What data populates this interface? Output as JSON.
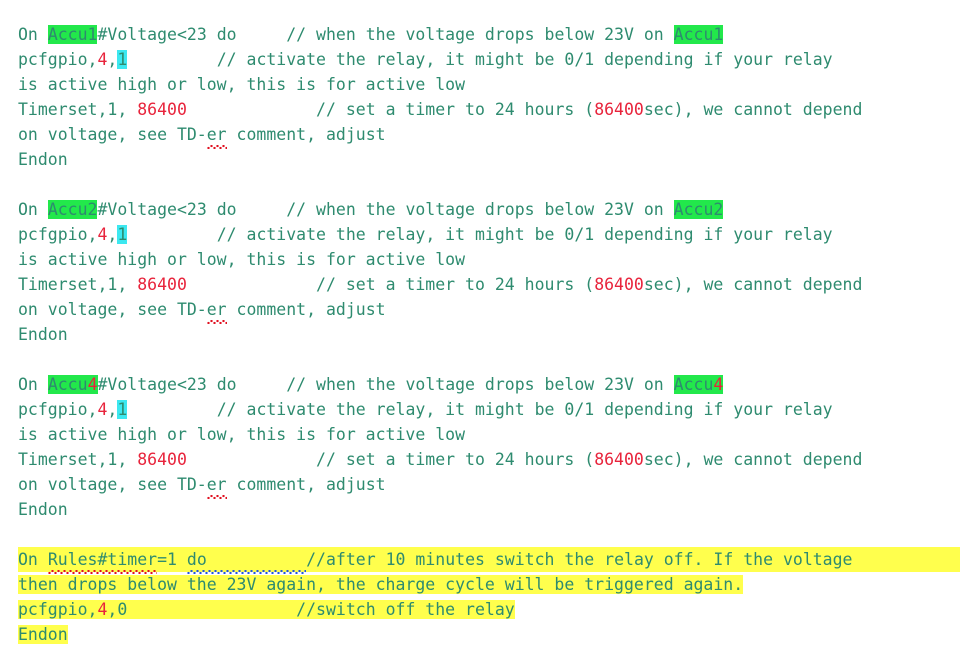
{
  "document": {
    "type": "code-editor-text",
    "language": "tasmota-rules",
    "colors": {
      "text": "#2e8b6f",
      "number": "#e8243c",
      "highlight_green": "#22e84b",
      "highlight_cyan": "#3ce8f0",
      "highlight_yellow": "#ffff4d",
      "spell_error": "#e01020",
      "grammar_error": "#2255dd",
      "background": "#ffffff"
    },
    "blocks": [
      {
        "id": "rule-accu1",
        "device": "Accu1",
        "lines": [
          {
            "id": "accu1-trigger",
            "segments": [
              {
                "text": "On ",
                "style": "plain"
              },
              {
                "text": "Accu1",
                "style": "highlight-green"
              },
              {
                "text": "#Voltage<23 do     ",
                "style": "plain"
              },
              {
                "text": "// when the voltage drops below 23V on ",
                "style": "plain"
              },
              {
                "text": "Accu1",
                "style": "highlight-green"
              }
            ]
          },
          {
            "id": "accu1-action",
            "segments": [
              {
                "text": "pcfgpio,",
                "style": "plain"
              },
              {
                "text": "4",
                "style": "number"
              },
              {
                "text": ",",
                "style": "plain"
              },
              {
                "text": "1",
                "style": "highlight-cyan"
              },
              {
                "text": "         ",
                "style": "plain"
              },
              {
                "text": "// activate the relay, it might be 0/1 depending if your relay",
                "style": "plain"
              }
            ]
          },
          {
            "id": "accu1-comment-wrap",
            "segments": [
              {
                "text": "is active high or low, this is for active low",
                "style": "plain"
              }
            ]
          },
          {
            "id": "accu1-timer",
            "segments": [
              {
                "text": "Timerset,1, ",
                "style": "plain"
              },
              {
                "text": "86400",
                "style": "number"
              },
              {
                "text": "             ",
                "style": "plain"
              },
              {
                "text": "// set a timer to 24 hours (",
                "style": "plain"
              },
              {
                "text": "86400",
                "style": "number"
              },
              {
                "text": "sec), we cannot depend",
                "style": "plain"
              }
            ]
          },
          {
            "id": "accu1-comment-wrap2",
            "segments": [
              {
                "text": "on voltage, see TD-",
                "style": "plain"
              },
              {
                "text": "er",
                "style": "spell-error"
              },
              {
                "text": " comment, adjust",
                "style": "plain"
              }
            ]
          },
          {
            "id": "accu1-endon",
            "segments": [
              {
                "text": "Endon",
                "style": "plain"
              }
            ]
          }
        ]
      },
      {
        "id": "rule-accu2",
        "device": "Accu2",
        "lines": [
          {
            "id": "accu2-trigger",
            "segments": [
              {
                "text": "On ",
                "style": "plain"
              },
              {
                "text": "Accu2",
                "style": "highlight-green"
              },
              {
                "text": "#Voltage<23 do     ",
                "style": "plain"
              },
              {
                "text": "// when the voltage drops below 23V on ",
                "style": "plain"
              },
              {
                "text": "Accu2",
                "style": "highlight-green"
              }
            ]
          },
          {
            "id": "accu2-action",
            "segments": [
              {
                "text": "pcfgpio,",
                "style": "plain"
              },
              {
                "text": "4",
                "style": "number"
              },
              {
                "text": ",",
                "style": "plain"
              },
              {
                "text": "1",
                "style": "highlight-cyan"
              },
              {
                "text": "         ",
                "style": "plain"
              },
              {
                "text": "// activate the relay, it might be 0/1 depending if your relay",
                "style": "plain"
              }
            ]
          },
          {
            "id": "accu2-comment-wrap",
            "segments": [
              {
                "text": "is active high or low, this is for active low",
                "style": "plain"
              }
            ]
          },
          {
            "id": "accu2-timer",
            "segments": [
              {
                "text": "Timerset,1, ",
                "style": "plain"
              },
              {
                "text": "86400",
                "style": "number"
              },
              {
                "text": "             ",
                "style": "plain"
              },
              {
                "text": "// set a timer to 24 hours (",
                "style": "plain"
              },
              {
                "text": "86400",
                "style": "number"
              },
              {
                "text": "sec), we cannot depend",
                "style": "plain"
              }
            ]
          },
          {
            "id": "accu2-comment-wrap2",
            "segments": [
              {
                "text": "on voltage, see TD-",
                "style": "plain"
              },
              {
                "text": "er",
                "style": "spell-error"
              },
              {
                "text": " comment, adjust",
                "style": "plain"
              }
            ]
          },
          {
            "id": "accu2-endon",
            "segments": [
              {
                "text": "Endon",
                "style": "plain"
              }
            ]
          }
        ]
      },
      {
        "id": "rule-accu4",
        "device": "Accu4",
        "lines": [
          {
            "id": "accu4-trigger",
            "segments": [
              {
                "text": "On ",
                "style": "plain"
              },
              {
                "text": "Accu",
                "style": "highlight-green"
              },
              {
                "text": "4",
                "style": "highlight-green-number"
              },
              {
                "text": "#Voltage<23 do     ",
                "style": "plain"
              },
              {
                "text": "// when the voltage drops below 23V on ",
                "style": "plain"
              },
              {
                "text": "Accu",
                "style": "highlight-green"
              },
              {
                "text": "4",
                "style": "highlight-green-number"
              }
            ]
          },
          {
            "id": "accu4-action",
            "segments": [
              {
                "text": "pcfgpio,",
                "style": "plain"
              },
              {
                "text": "4",
                "style": "number"
              },
              {
                "text": ",",
                "style": "plain"
              },
              {
                "text": "1",
                "style": "highlight-cyan"
              },
              {
                "text": "         ",
                "style": "plain"
              },
              {
                "text": "// activate the relay, it might be 0/1 depending if your relay",
                "style": "plain"
              }
            ]
          },
          {
            "id": "accu4-comment-wrap",
            "segments": [
              {
                "text": "is active high or low, this is for active low",
                "style": "plain"
              }
            ]
          },
          {
            "id": "accu4-timer",
            "segments": [
              {
                "text": "Timerset,1, ",
                "style": "plain"
              },
              {
                "text": "86400",
                "style": "number"
              },
              {
                "text": "             ",
                "style": "plain"
              },
              {
                "text": "// set a timer to 24 hours (",
                "style": "plain"
              },
              {
                "text": "86400",
                "style": "number"
              },
              {
                "text": "sec), we cannot depend",
                "style": "plain"
              }
            ]
          },
          {
            "id": "accu4-comment-wrap2",
            "segments": [
              {
                "text": "on voltage, see TD-",
                "style": "plain"
              },
              {
                "text": "er",
                "style": "spell-error"
              },
              {
                "text": " comment, adjust",
                "style": "plain"
              }
            ]
          },
          {
            "id": "accu4-endon",
            "segments": [
              {
                "text": "Endon",
                "style": "plain"
              }
            ]
          }
        ]
      },
      {
        "id": "rule-timer",
        "device": "Rules#timer",
        "highlighted": true,
        "lines": [
          {
            "id": "timer-trigger",
            "highlight": "yellow-full",
            "segments": [
              {
                "text": "On ",
                "style": "plain"
              },
              {
                "text": "Rules#timer",
                "style": "spell-error"
              },
              {
                "text": "=1 ",
                "style": "plain"
              },
              {
                "text": "do          ",
                "style": "grammar-error"
              },
              {
                "text": "//after 10 minutes switch the relay off. If the voltage",
                "style": "plain"
              }
            ]
          },
          {
            "id": "timer-comment-wrap",
            "highlight": "yellow-fit",
            "segments": [
              {
                "text": "then drops below the 23V again, the charge cycle will be triggered again.",
                "style": "plain"
              }
            ]
          },
          {
            "id": "timer-action",
            "highlight": "yellow-fit",
            "segments": [
              {
                "text": "pcfgpio,",
                "style": "plain"
              },
              {
                "text": "4",
                "style": "number"
              },
              {
                "text": ",0                 ",
                "style": "plain"
              },
              {
                "text": "//switch off the relay",
                "style": "plain"
              }
            ]
          },
          {
            "id": "timer-endon",
            "highlight": "yellow-fit",
            "segments": [
              {
                "text": "Endon",
                "style": "plain"
              }
            ]
          }
        ]
      }
    ]
  }
}
